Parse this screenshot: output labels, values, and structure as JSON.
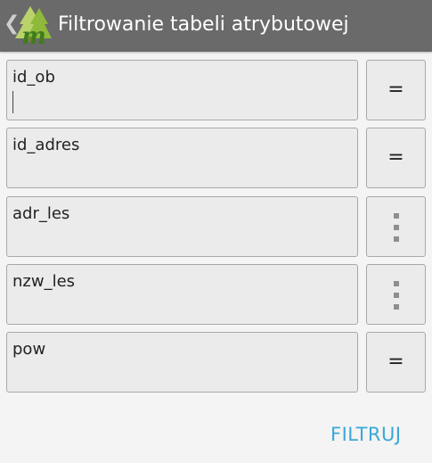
{
  "appbar": {
    "title": "Filtrowanie tabeli atrybutowej",
    "back_glyph": "❮",
    "logo_letter": "m",
    "colors": {
      "bar": "#6a6a6a",
      "logo_tree": "#9ac43a",
      "logo_letter": "#3f7b1e"
    }
  },
  "fields": [
    {
      "label": "id_ob",
      "operator": "=",
      "operator_type": "equals",
      "focused": true
    },
    {
      "label": "id_adres",
      "operator": "=",
      "operator_type": "equals",
      "focused": false
    },
    {
      "label": "adr_les",
      "operator": "",
      "operator_type": "more-vertical-icon",
      "focused": false
    },
    {
      "label": "nzw_les",
      "operator": "",
      "operator_type": "more-vertical-icon",
      "focused": false
    },
    {
      "label": "pow",
      "operator": "=",
      "operator_type": "equals",
      "focused": false
    }
  ],
  "actions": {
    "filter_label": "FILTRUJ",
    "accent": "#3aa8d8"
  }
}
